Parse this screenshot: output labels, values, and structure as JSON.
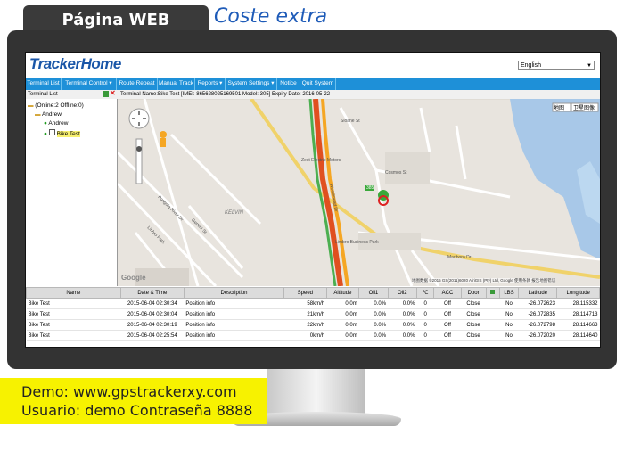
{
  "banner": {
    "web_label": "Página WEB",
    "extra_label": "Coste extra"
  },
  "app": {
    "logo": "TrackerHome",
    "language": "English",
    "nav": [
      "Terminal List",
      "Terminal Control",
      "Route Repeat",
      "Manual Track",
      "Reports",
      "System Settings",
      "Notice",
      "Quit System"
    ],
    "info": "Terminal Name:Bike Test [IMEI: 865628025169501  Model: 305]  Expiry Date: 2016-05-22",
    "tree": {
      "title": "Terminal List",
      "online": "Online:2   Offline:0)",
      "group": "Andrew",
      "devices": [
        "Andrew",
        "Bike Test"
      ]
    },
    "map": {
      "btn_map": "地图",
      "btn_sat": "卫星图像",
      "marker_label": "385",
      "labels": [
        "Zest Electric Motors",
        "Limbro Business Park",
        "KELVIN",
        "Marlboro Dr",
        "Woodmead Dr",
        "Sloane St",
        "Linbro Park",
        "Gemini St",
        "Pongola River Dr",
        "Cosmos St"
      ],
      "google": "Google",
      "copyright": "地图数据 ©2015 GS(2011)6020 AfriGIS (Pty) Ltd, Google   使用条款   报告地图错误"
    }
  },
  "grid": {
    "columns": [
      "Name",
      "Date & Time",
      "Description",
      "Speed",
      "Altitude",
      "Oil1",
      "Oil2",
      "℃",
      "ACC",
      "Door",
      "",
      "LBS",
      "Latitude",
      "Longitude"
    ],
    "rows": [
      [
        "Bike Test",
        "2015-06-04 02:30:34",
        "Position info",
        "58km/h",
        "0.0m",
        "0.0%",
        "0.0%",
        "0",
        "Off",
        "Close",
        "",
        "No",
        "-26.072623",
        "28.115332"
      ],
      [
        "Bike Test",
        "2015-06-04 02:30:04",
        "Position info",
        "21km/h",
        "0.0m",
        "0.0%",
        "0.0%",
        "0",
        "Off",
        "Close",
        "",
        "No",
        "-26.072835",
        "28.114713"
      ],
      [
        "Bike Test",
        "2015-06-04 02:30:19",
        "Position info",
        "22km/h",
        "0.0m",
        "0.0%",
        "0.0%",
        "0",
        "Off",
        "Close",
        "",
        "No",
        "-26.072798",
        "28.114663"
      ],
      [
        "Bike Test",
        "2015-06-04 02:25:54",
        "Position info",
        "0km/h",
        "0.0m",
        "0.0%",
        "0.0%",
        "0",
        "Off",
        "Close",
        "",
        "No",
        "-26.072020",
        "28.114640"
      ]
    ]
  },
  "demo": {
    "line1": "Demo: www.gpstrackerxy.com",
    "line2": "Usuario: demo   Contraseña 8888"
  }
}
